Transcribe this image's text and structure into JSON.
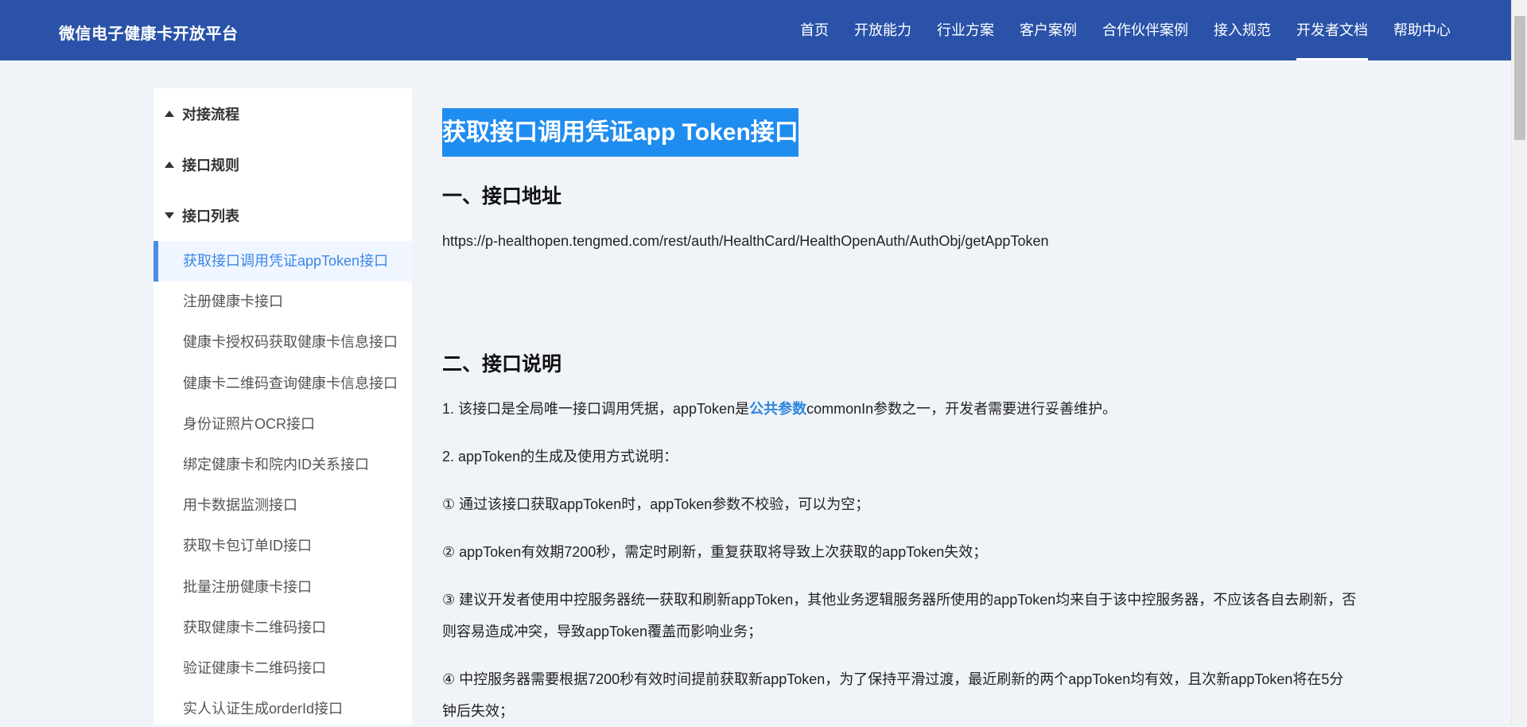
{
  "header": {
    "brand": "微信电子健康卡开放平台",
    "nav": [
      {
        "label": "首页"
      },
      {
        "label": "开放能力"
      },
      {
        "label": "行业方案"
      },
      {
        "label": "客户案例"
      },
      {
        "label": "合作伙伴案例"
      },
      {
        "label": "接入规范"
      },
      {
        "label": "开发者文档",
        "active": true
      },
      {
        "label": "帮助中心"
      }
    ]
  },
  "sidebar": {
    "groups": [
      {
        "label": "对接流程",
        "expanded": false
      },
      {
        "label": "接口规则",
        "expanded": false
      },
      {
        "label": "接口列表",
        "expanded": true
      }
    ],
    "items": [
      {
        "label": "获取接口调用凭证appToken接口",
        "active": true
      },
      {
        "label": "注册健康卡接口"
      },
      {
        "label": "健康卡授权码获取健康卡信息接口"
      },
      {
        "label": "健康卡二维码查询健康卡信息接口"
      },
      {
        "label": "身份证照片OCR接口"
      },
      {
        "label": "绑定健康卡和院内ID关系接口"
      },
      {
        "label": "用卡数据监测接口"
      },
      {
        "label": "获取卡包订单ID接口"
      },
      {
        "label": "批量注册健康卡接口"
      },
      {
        "label": "获取健康卡二维码接口"
      },
      {
        "label": "验证健康卡二维码接口"
      },
      {
        "label": "实人认证生成orderId接口"
      }
    ]
  },
  "main": {
    "title": "获取接口调用凭证app Token接口",
    "section1_title": "一、接口地址",
    "url": "https://p-healthopen.tengmed.com/rest/auth/HealthCard/HealthOpenAuth/AuthObj/getAppToken",
    "section2_title": "二、接口说明",
    "p1_before": "1. 该接口是全局唯一接口调用凭据，appToken是",
    "p1_link": "公共参数",
    "p1_after": "commonIn参数之一，开发者需要进行妥善维护。",
    "p2": "2. appToken的生成及使用方式说明：",
    "p3": "① 通过该接口获取appToken时，appToken参数不校验，可以为空；",
    "p4": "② appToken有效期7200秒，需定时刷新，重复获取将导致上次获取的appToken失效；",
    "p5": "③ 建议开发者使用中控服务器统一获取和刷新appToken，其他业务逻辑服务器所使用的appToken均来自于该中控服务器，不应该各自去刷新，否则容易造成冲突，导致appToken覆盖而影响业务；",
    "p6": "④ 中控服务器需要根据7200秒有效时间提前获取新appToken，为了保持平滑过渡，最近刷新的两个appToken均有效，且次新appToken将在5分钟后失效；"
  }
}
